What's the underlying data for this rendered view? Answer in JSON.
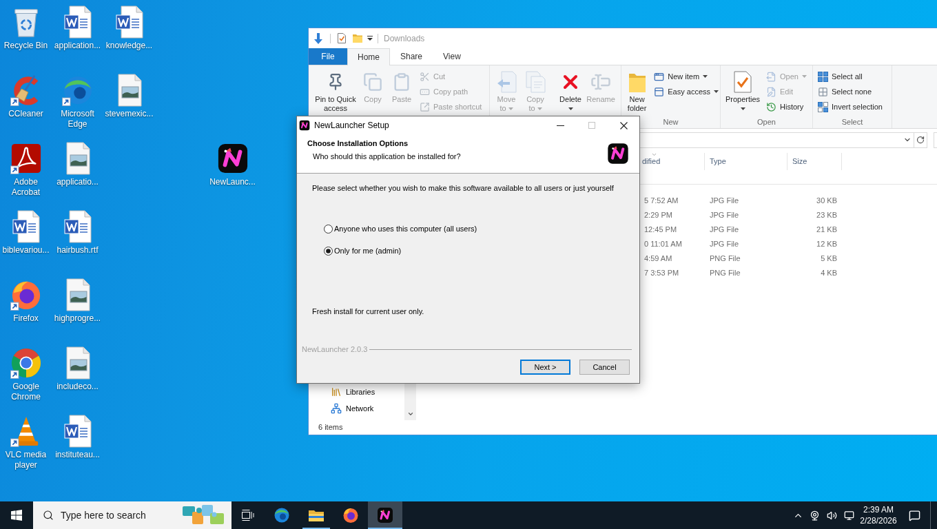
{
  "desktop": {
    "icons": [
      {
        "label": "Recycle Bin",
        "kind": "recycle-bin",
        "shortcut": false
      },
      {
        "label": "CCleaner",
        "kind": "ccleaner",
        "shortcut": true
      },
      {
        "label": "Adobe Acrobat",
        "kind": "acrobat",
        "shortcut": true
      },
      {
        "label": "biblevariou...",
        "kind": "word",
        "shortcut": false
      },
      {
        "label": "Firefox",
        "kind": "firefox",
        "shortcut": true
      },
      {
        "label": "Google Chrome",
        "kind": "chrome",
        "shortcut": true
      },
      {
        "label": "VLC media player",
        "kind": "vlc",
        "shortcut": true
      },
      {
        "label": "application...",
        "kind": "word",
        "shortcut": false
      },
      {
        "label": "Microsoft Edge",
        "kind": "edge",
        "shortcut": true
      },
      {
        "label": "applicatio...",
        "kind": "image",
        "shortcut": false
      },
      {
        "label": "hairbush.rtf",
        "kind": "word",
        "shortcut": false
      },
      {
        "label": "highprogre...",
        "kind": "image",
        "shortcut": false
      },
      {
        "label": "includeco...",
        "kind": "image",
        "shortcut": false
      },
      {
        "label": "instituteau...",
        "kind": "word",
        "shortcut": false
      },
      {
        "label": "knowledge...",
        "kind": "word",
        "shortcut": false
      },
      {
        "label": "stevemexic...",
        "kind": "image",
        "shortcut": false
      },
      {
        "label": "NewLaunc...",
        "kind": "newlauncher",
        "shortcut": false
      }
    ]
  },
  "explorer": {
    "title": "Downloads",
    "ribbon_tabs": [
      {
        "label": "File",
        "kind": "file",
        "selected": false
      },
      {
        "label": "Home",
        "kind": "tab",
        "selected": true
      },
      {
        "label": "Share",
        "kind": "tab",
        "selected": false
      },
      {
        "label": "View",
        "kind": "tab",
        "selected": false
      }
    ],
    "ribbon_groups": [
      {
        "large": [
          {
            "label": "Pin to Quick access",
            "kind": "pin",
            "disabled": false,
            "dropdown": false
          },
          {
            "label": "Copy",
            "kind": "copy",
            "disabled": true,
            "dropdown": false
          },
          {
            "label": "Paste",
            "kind": "paste",
            "disabled": true,
            "dropdown": false
          }
        ],
        "small": [
          {
            "label": "Cut",
            "kind": "cut",
            "disabled": true,
            "dropdown": false
          },
          {
            "label": "Copy path",
            "kind": "copypath",
            "disabled": true,
            "dropdown": false
          },
          {
            "label": "Paste shortcut",
            "kind": "pasteshortcut",
            "disabled": true,
            "dropdown": false
          }
        ]
      },
      {
        "large": [
          {
            "label": "Move to",
            "kind": "moveto",
            "disabled": true,
            "dropdown": true
          },
          {
            "label": "Copy to",
            "kind": "copyto",
            "disabled": true,
            "dropdown": true
          },
          {
            "label": "Delete",
            "kind": "delete",
            "disabled": false,
            "dropdown": true
          },
          {
            "label": "Rename",
            "kind": "rename",
            "disabled": true,
            "dropdown": false
          }
        ]
      },
      {
        "label": "New",
        "large": [
          {
            "label": "New folder",
            "kind": "newfolder",
            "disabled": false,
            "dropdown": false
          }
        ],
        "small": [
          {
            "label": "New item",
            "kind": "newitem",
            "disabled": false,
            "dropdown": true
          },
          {
            "label": "Easy access",
            "kind": "easyaccess",
            "disabled": false,
            "dropdown": true
          }
        ]
      },
      {
        "label": "Open",
        "large": [
          {
            "label": "Properties",
            "kind": "properties",
            "disabled": false,
            "dropdown": true
          }
        ],
        "small": [
          {
            "label": "Open",
            "kind": "open",
            "disabled": true,
            "dropdown": true
          },
          {
            "label": "Edit",
            "kind": "edit",
            "disabled": true,
            "dropdown": false
          },
          {
            "label": "History",
            "kind": "history",
            "disabled": false,
            "dropdown": false
          }
        ]
      },
      {
        "label": "Select",
        "small": [
          {
            "label": "Select all",
            "kind": "selectall",
            "disabled": false,
            "dropdown": false
          },
          {
            "label": "Select none",
            "kind": "selectnone",
            "disabled": false,
            "dropdown": false
          },
          {
            "label": "Invert selection",
            "kind": "invert",
            "disabled": false,
            "dropdown": false
          }
        ]
      }
    ],
    "columns": [
      {
        "label": "dified",
        "sorted": true
      },
      {
        "label": "Type",
        "sorted": false
      },
      {
        "label": "Size",
        "sorted": false
      }
    ],
    "rows": [
      {
        "modified": "5 7:52 AM",
        "type": "JPG File",
        "size": "30 KB"
      },
      {
        "modified": "2:29 PM",
        "type": "JPG File",
        "size": "23 KB"
      },
      {
        "modified": "12:45 PM",
        "type": "JPG File",
        "size": "21 KB"
      },
      {
        "modified": "0 11:01 AM",
        "type": "JPG File",
        "size": "12 KB"
      },
      {
        "modified": "4:59 AM",
        "type": "PNG File",
        "size": "5 KB"
      },
      {
        "modified": "7 3:53 PM",
        "type": "PNG File",
        "size": "4 KB"
      }
    ],
    "nav_items": [
      {
        "label": "Libraries",
        "kind": "libraries"
      },
      {
        "label": "Network",
        "kind": "network"
      }
    ],
    "status": "6 items"
  },
  "setup_dialog": {
    "title": "NewLauncher Setup",
    "title_buttons": [
      {
        "kind": "minimize",
        "disabled": false
      },
      {
        "kind": "maximize",
        "disabled": true
      },
      {
        "kind": "close",
        "disabled": false
      }
    ],
    "heading": "Choose Installation Options",
    "subheading": "Who should this application be installed for?",
    "prompt": "Please select whether you wish to make this software available to all users or just yourself",
    "options": [
      {
        "label": "Anyone who uses this computer (all users)",
        "selected": false
      },
      {
        "label": "Only for me (admin)",
        "selected": true
      }
    ],
    "note": "Fresh install for current user only.",
    "branding": "NewLauncher 2.0.3",
    "buttons": [
      {
        "label": "Next >",
        "focused": true
      },
      {
        "label": "Cancel",
        "focused": false
      }
    ]
  },
  "taskbar": {
    "search": {
      "placeholder": "Type here to search"
    },
    "apps": [
      {
        "kind": "edge",
        "running": false,
        "active": false
      },
      {
        "kind": "explorer",
        "running": true,
        "active": false
      },
      {
        "kind": "firefox",
        "running": false,
        "active": false
      },
      {
        "kind": "newlauncher",
        "running": true,
        "active": true
      }
    ],
    "clock": {
      "time": "2:39 AM",
      "date": "2/28/2026"
    }
  }
}
